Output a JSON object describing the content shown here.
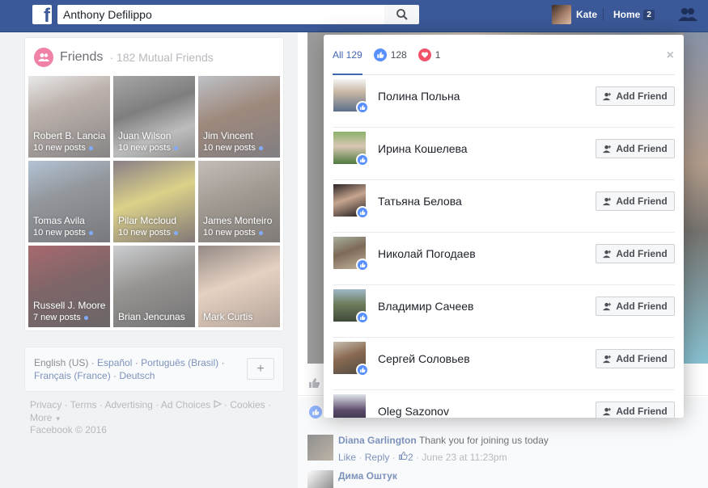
{
  "header": {
    "search_value": "Anthony Defilippo",
    "user_name": "Kate",
    "home_label": "Home",
    "home_count": "2"
  },
  "friends": {
    "title": "Friends",
    "subtitle": "· 182 Mutual Friends",
    "tiles": [
      {
        "name": "Robert B. Lancia",
        "posts": "10 new posts"
      },
      {
        "name": "Juan Wilson",
        "posts": "10 new posts"
      },
      {
        "name": "Jim Vincent",
        "posts": "10 new posts"
      },
      {
        "name": "Tomas Avila",
        "posts": "10 new posts"
      },
      {
        "name": "Pilar Mccloud",
        "posts": "10 new posts"
      },
      {
        "name": "James Monteiro",
        "posts": "10 new posts"
      },
      {
        "name": "Russell J. Moore",
        "posts": "7 new posts"
      },
      {
        "name": "Brian Jencunas",
        "posts": ""
      },
      {
        "name": "Mark Curtis",
        "posts": ""
      }
    ]
  },
  "languages": {
    "current": "English (US) ·",
    "links": [
      "Español",
      "Português (Brasil)",
      "Français (France)",
      "Deutsch"
    ],
    "add": "+"
  },
  "footer": {
    "links": [
      "Privacy",
      "Terms",
      "Advertising",
      "Ad Choices",
      "Cookies",
      "More"
    ],
    "copyright": "Facebook © 2016"
  },
  "comments": [
    {
      "name": "Diana Garlington",
      "text": "Thank you for joining us today",
      "like": "Like",
      "reply": "Reply",
      "likes": "2",
      "time": "· June 23 at 11:23pm"
    },
    {
      "name": "Дима Оштук"
    }
  ],
  "reactions_modal": {
    "tabs": {
      "all": "All 129",
      "like_count": "128",
      "love_count": "1"
    },
    "close": "×",
    "add_friend_label": "Add Friend",
    "people": [
      {
        "name": "Полина Польна"
      },
      {
        "name": "Ирина Кошелева"
      },
      {
        "name": "Татьяна Белова"
      },
      {
        "name": "Николай Погодаев"
      },
      {
        "name": "Владимир Сачеев"
      },
      {
        "name": "Сергей Соловьев"
      },
      {
        "name": "Oleg Sazonov"
      }
    ]
  },
  "colors": {
    "brand": "#3b5998",
    "link": "#365899",
    "like": "#5890ff",
    "love": "#f25268",
    "friends_badge": "#e9407a"
  }
}
